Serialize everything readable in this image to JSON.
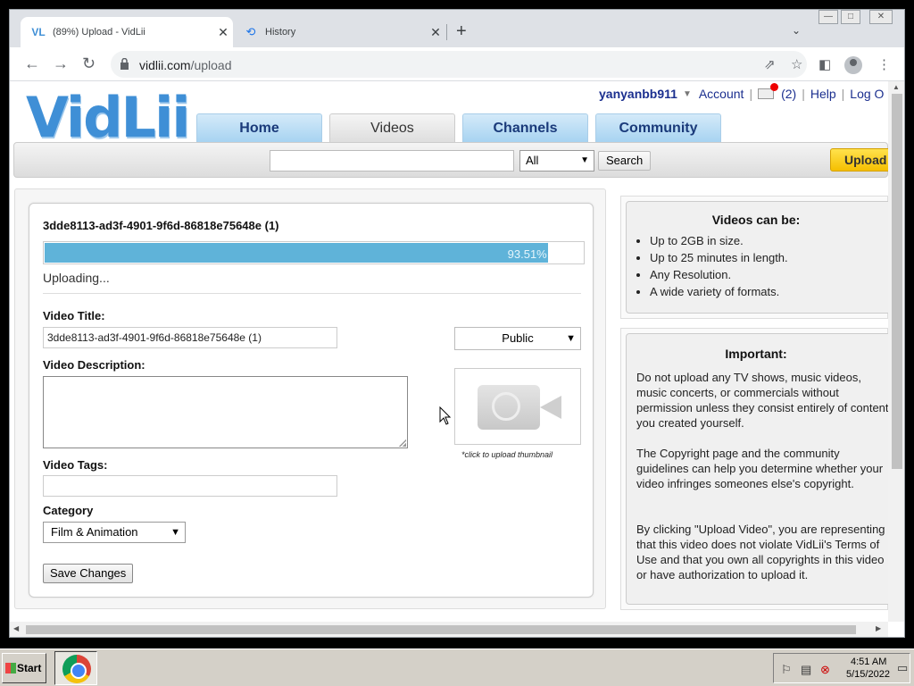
{
  "browser": {
    "tabs": [
      {
        "title": "(89%) Upload - VidLii",
        "icon": "vidlii-icon",
        "active": true
      },
      {
        "title": "History",
        "icon": "history-icon",
        "active": false
      }
    ],
    "url_domain": "vidlii.com",
    "url_path": "/upload"
  },
  "site": {
    "logo": "VidLii",
    "username": "yanyanbb911",
    "account_label": "Account",
    "messages_count": "(2)",
    "help_label": "Help",
    "logout_label": "Log O",
    "nav": [
      "Home",
      "Videos",
      "Channels",
      "Community"
    ],
    "active_nav": "Videos",
    "search": {
      "placeholder": "",
      "filter": "All",
      "button": "Search"
    },
    "upload_button": "Upload"
  },
  "upload": {
    "file_name": "3dde8113-ad3f-4901-9f6d-86818e75648e (1)",
    "progress_percent": 93.51,
    "progress_label": "93.51%",
    "status": "Uploading...",
    "title_label": "Video Title:",
    "title_value": "3dde8113-ad3f-4901-9f6d-86818e75648e (1)",
    "description_label": "Video Description:",
    "description_value": "",
    "tags_label": "Video Tags:",
    "tags_value": "",
    "category_label": "Category",
    "category_value": "Film & Animation",
    "privacy_value": "Public",
    "thumbnail_caption": "*click to upload thumbnail",
    "save_button": "Save Changes"
  },
  "sidebar": {
    "limits_title": "Videos can be:",
    "limits": [
      "Up to 2GB in size.",
      "Up to 25 minutes in length.",
      "Any Resolution.",
      "A wide variety of formats."
    ],
    "important_title": "Important:",
    "important_paragraphs": [
      "Do not upload any TV shows, music videos, music concerts, or commercials without permission unless they consist entirely of content you created yourself.",
      "The Copyright page and the community guidelines can help you determine whether your video infringes someones else's copyright.",
      "By clicking \"Upload Video\", you are representing that this video does not violate VidLii's Terms of Use and that you own all copyrights in this video or have authorization to upload it."
    ]
  },
  "taskbar": {
    "start_label": "Start",
    "time": "4:51 AM",
    "date": "5/15/2022"
  },
  "colors": {
    "progress_fill": "#5fb3d9",
    "logo_blue": "#3f8fd6",
    "link_blue": "#1b2f8f",
    "upload_yellow": "#f5bf00"
  }
}
